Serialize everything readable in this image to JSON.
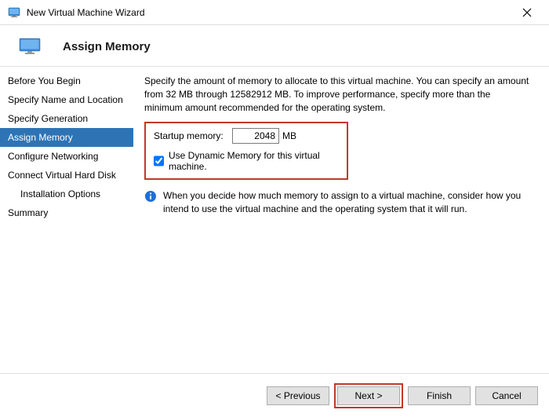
{
  "window": {
    "title": "New Virtual Machine Wizard"
  },
  "header": {
    "heading": "Assign Memory"
  },
  "sidebar": {
    "items": [
      {
        "label": "Before You Begin"
      },
      {
        "label": "Specify Name and Location"
      },
      {
        "label": "Specify Generation"
      },
      {
        "label": "Assign Memory"
      },
      {
        "label": "Configure Networking"
      },
      {
        "label": "Connect Virtual Hard Disk"
      },
      {
        "label": "Installation Options"
      },
      {
        "label": "Summary"
      }
    ]
  },
  "content": {
    "description": "Specify the amount of memory to allocate to this virtual machine. You can specify an amount from 32 MB through 12582912 MB. To improve performance, specify more than the minimum amount recommended for the operating system.",
    "startup_label": "Startup memory:",
    "startup_value": "2048",
    "startup_unit": "MB",
    "dynamic_label": "Use Dynamic Memory for this virtual machine.",
    "info_text": "When you decide how much memory to assign to a virtual machine, consider how you intend to use the virtual machine and the operating system that it will run."
  },
  "footer": {
    "previous": "< Previous",
    "next": "Next >",
    "finish": "Finish",
    "cancel": "Cancel"
  }
}
